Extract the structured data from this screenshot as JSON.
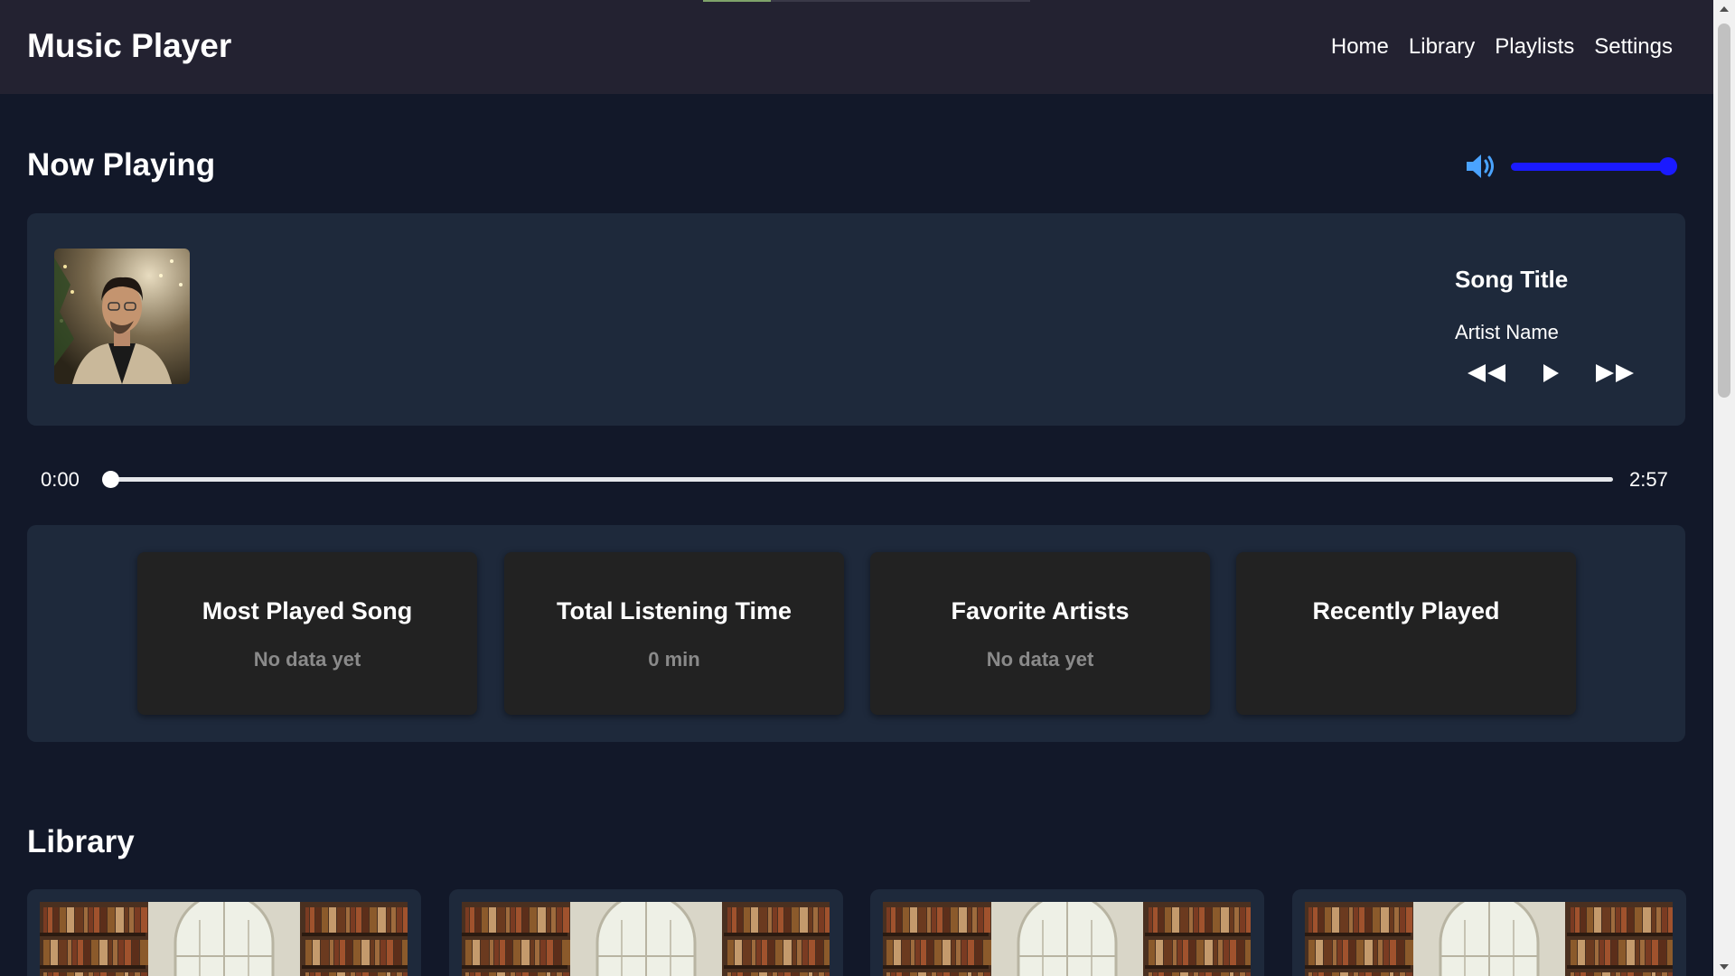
{
  "header": {
    "title": "Music Player",
    "nav": [
      "Home",
      "Library",
      "Playlists",
      "Settings"
    ]
  },
  "now_playing": {
    "heading": "Now Playing",
    "song_title": "Song Title",
    "artist_name": "Artist Name",
    "volume_level": 1.0,
    "current_time": "0:00",
    "total_time": "2:57",
    "progress": 0.0
  },
  "stats": [
    {
      "title": "Most Played Song",
      "value": "No data yet"
    },
    {
      "title": "Total Listening Time",
      "value": "0 min"
    },
    {
      "title": "Favorite Artists",
      "value": "No data yet"
    },
    {
      "title": "Recently Played",
      "value": ""
    }
  ],
  "library": {
    "heading": "Library",
    "items_visible": 4
  },
  "colors": {
    "background": "#121829",
    "header": "#232231",
    "card": "#1e293b",
    "stat_card": "#222222",
    "accent": "#1a1aff",
    "volume_icon": "#4aa3ff",
    "muted_text": "#8a8a8a"
  },
  "icons": {
    "volume": "speaker-volume-icon",
    "prev": "rewind-icon",
    "play": "play-icon",
    "next": "fast-forward-icon"
  }
}
